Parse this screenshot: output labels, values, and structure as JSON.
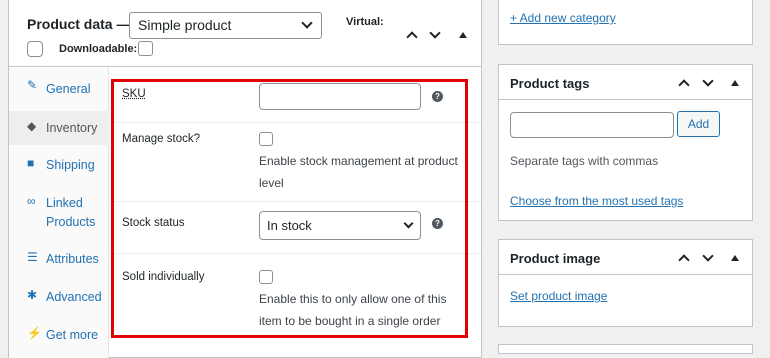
{
  "product_data": {
    "title": "Product data —",
    "type_select": "Simple product",
    "virtual_label": "Virtual:",
    "downloadable_label": "Downloadable:"
  },
  "tabs": [
    {
      "label": "General",
      "icon": "wrench-icon"
    },
    {
      "label": "Inventory",
      "icon": "tag-icon"
    },
    {
      "label": "Shipping",
      "icon": "truck-icon"
    },
    {
      "label": "Linked Products",
      "icon": "link-icon"
    },
    {
      "label": "Attributes",
      "icon": "list-icon"
    },
    {
      "label": "Advanced",
      "icon": "gear-icon"
    },
    {
      "label": "Get more",
      "icon": "plug-icon"
    }
  ],
  "inventory": {
    "sku_label": "SKU",
    "sku_value": "",
    "manage_stock_label": "Manage stock?",
    "manage_stock_desc_1": "Enable stock management at product",
    "manage_stock_desc_2": "level",
    "stock_status_label": "Stock status",
    "stock_status_value": "In stock",
    "sold_individually_label": "Sold individually",
    "sold_individually_desc_1": "Enable this to only allow one of this",
    "sold_individually_desc_2": "item to be bought in a single order",
    "help_glyph": "?"
  },
  "sidebar": {
    "add_new_category": "+ Add new category",
    "product_tags": {
      "title": "Product tags",
      "tag_input": "",
      "add_button": "Add",
      "hint": "Separate tags with commas",
      "choose_link": "Choose from the most used tags"
    },
    "product_image": {
      "title": "Product image",
      "set_link": "Set product image"
    }
  },
  "colors": {
    "highlight": "#e20000",
    "link": "#2271b1"
  }
}
